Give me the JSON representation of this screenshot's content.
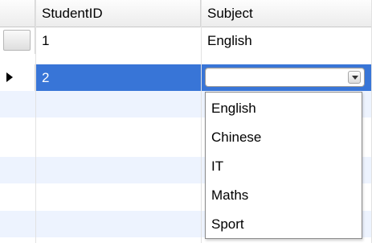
{
  "grid": {
    "columns": [
      "StudentID",
      "Subject"
    ],
    "rows": [
      {
        "student_id": "1",
        "subject": "English"
      },
      {
        "student_id": "2",
        "subject": ""
      }
    ]
  },
  "editor": {
    "current_value": "",
    "options": [
      "English",
      "Chinese",
      "IT",
      "Maths",
      "Sport"
    ]
  },
  "colors": {
    "selection": "#3875d7",
    "alternate_row": "#edf3fe"
  },
  "icons": {
    "row_pointer": "triangle-right",
    "combo_arrow": "chevron-down"
  }
}
